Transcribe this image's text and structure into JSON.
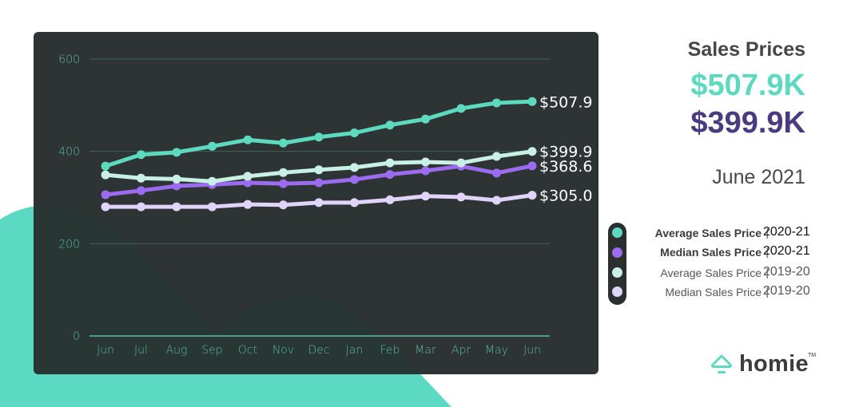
{
  "header": {
    "title": "Sales Prices",
    "headline_avg": "$507.9K",
    "headline_median": "$399.9K",
    "date": "June 2021"
  },
  "colors": {
    "background_shape": "#5cd9c2",
    "card": "#2e3433",
    "card_shadow_shape": "#283634",
    "grid": "#3f5f57",
    "axis": "#5bb8a2",
    "tick_text": "#5bb8a2",
    "avg_2020_21": "#5dd9bf",
    "median_2020_21": "#9b6cf0",
    "avg_2019_20": "#c8f0e4",
    "median_2019_20": "#e0d4fa",
    "headline_median": "#4a3a80"
  },
  "legend": [
    {
      "name": "Average Sales Price",
      "separator": "|",
      "period": "2020-21",
      "color": "#5dd9bf",
      "emphasis": "bold"
    },
    {
      "name": "Median Sales Price",
      "separator": "|",
      "period": "2020-21",
      "color": "#9b6cf0",
      "emphasis": "bold"
    },
    {
      "name": "Average Sales Price",
      "separator": "|",
      "period": "2019-20",
      "color": "#c8f0e4",
      "emphasis": "light"
    },
    {
      "name": "Median Sales Price",
      "separator": "|",
      "period": "2019-20",
      "color": "#e0d4fa",
      "emphasis": "light"
    }
  ],
  "logo": {
    "text": "homie",
    "tm": "TM"
  },
  "chart_data": {
    "type": "line",
    "title": "Sales Prices",
    "xlabel": "",
    "ylabel": "",
    "categories": [
      "Jun",
      "Jul",
      "Aug",
      "Sep",
      "Oct",
      "Nov",
      "Dec",
      "Jan",
      "Feb",
      "Mar",
      "Apr",
      "May",
      "Jun"
    ],
    "ylim": [
      0,
      600
    ],
    "yticks": [
      0,
      200,
      400,
      600
    ],
    "grid": true,
    "legend_position": "right",
    "series": [
      {
        "name": "Average Sales Price | 2020-21",
        "color": "#5dd9bf",
        "values": [
          368,
          393,
          398,
          411,
          425,
          418,
          431,
          440,
          457,
          470,
          493,
          505,
          507.9
        ],
        "end_label": "$507.9"
      },
      {
        "name": "Average Sales Price | 2019-20",
        "color": "#c8f0e4",
        "values": [
          349,
          342,
          340,
          335,
          346,
          354,
          360,
          365,
          375,
          377,
          375,
          389,
          399.9
        ],
        "end_label": "$399.9"
      },
      {
        "name": "Median Sales Price | 2020-21",
        "color": "#9b6cf0",
        "values": [
          306,
          315,
          325,
          328,
          332,
          330,
          332,
          339,
          350,
          358,
          368,
          353,
          368.6
        ],
        "end_label": "$368.6"
      },
      {
        "name": "Median Sales Price | 2019-20",
        "color": "#e0d4fa",
        "values": [
          280,
          280,
          280,
          280,
          285,
          284,
          289,
          289,
          295,
          303,
          301,
          294,
          305.0
        ],
        "end_label": "$305.0"
      }
    ]
  }
}
